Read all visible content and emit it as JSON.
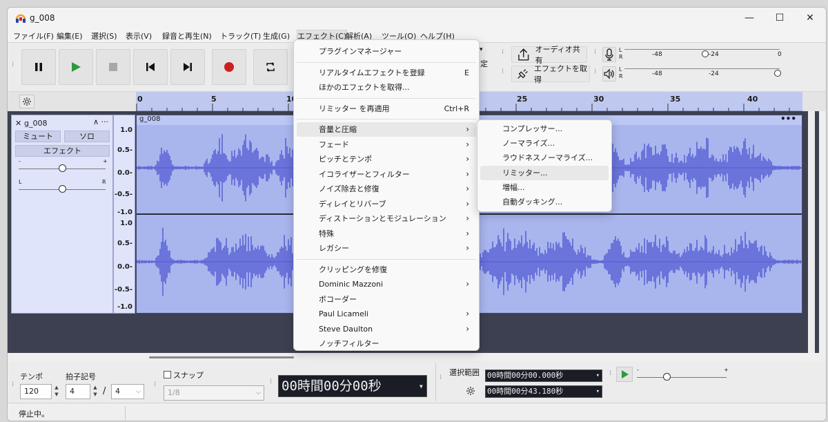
{
  "window": {
    "title": "g_008",
    "minimize": "—",
    "maximize": "☐",
    "close": "✕"
  },
  "menubar": [
    "ファイル(F)",
    "編集(E)",
    "選択(S)",
    "表示(V)",
    "録音と再生(N)",
    "トラック(T)",
    "生成(G)",
    "エフェクト(C)",
    "解析(A)",
    "ツール(O)",
    "ヘルプ(H)"
  ],
  "toolbar": {
    "share_audio": "オーディオ共有",
    "get_effects": "エフェクトを取得",
    "partial_setting_label": "設定",
    "meter_record": {
      "lr": [
        "L",
        "R"
      ],
      "ticks": [
        "-48",
        "-24",
        "0"
      ]
    },
    "meter_play": {
      "lr": [
        "L",
        "R"
      ],
      "ticks": [
        "-48",
        "-24"
      ]
    }
  },
  "ruler": {
    "labels": [
      "0",
      "5",
      "10",
      "25",
      "30",
      "35",
      "40"
    ]
  },
  "track": {
    "name": "g_008",
    "close": "✕",
    "collapse": "∧ ···",
    "mute": "ミュート",
    "solo": "ソロ",
    "effects": "エフェクト",
    "gain_minus": "-",
    "gain_plus": "+",
    "pan_left": "L",
    "pan_right": "R",
    "clip_name": "g_008",
    "clip_menu": "•••",
    "scale_top": [
      "1.0",
      "0.5-",
      "0.0-",
      "-0.5-",
      "-1.0"
    ],
    "scale_bottom": [
      "1.0",
      "0.5-",
      "0.0-",
      "-0.5-",
      "-1.0"
    ],
    "waveform_color": "#5a63d6",
    "clip_color": "#a9b6ee"
  },
  "effects_menu": {
    "items": [
      {
        "label": "プラグインマネージャー"
      },
      {
        "sep": true
      },
      {
        "label": "リアルタイムエフェクトを登録",
        "shortcut": "E"
      },
      {
        "label": "ほかのエフェクトを取得..."
      },
      {
        "sep": true
      },
      {
        "label": "リミッター を再適用",
        "shortcut": "Ctrl+R"
      },
      {
        "sep": true
      },
      {
        "label": "音量と圧縮",
        "submenu": true,
        "highlighted": true
      },
      {
        "label": "フェード",
        "submenu": true
      },
      {
        "label": "ピッチとテンポ",
        "submenu": true
      },
      {
        "label": "イコライザーとフィルター",
        "submenu": true
      },
      {
        "label": "ノイズ除去と修復",
        "submenu": true
      },
      {
        "label": "ディレイとリバーブ",
        "submenu": true
      },
      {
        "label": "ディストーションとモジュレーション",
        "submenu": true
      },
      {
        "label": "特殊",
        "submenu": true
      },
      {
        "label": "レガシー",
        "submenu": true
      },
      {
        "sep": true
      },
      {
        "label": "クリッピングを修復"
      },
      {
        "label": "Dominic Mazzoni",
        "submenu": true
      },
      {
        "label": "ボコーダー"
      },
      {
        "label": "Paul Licameli",
        "submenu": true
      },
      {
        "label": "Steve Daulton",
        "submenu": true
      },
      {
        "label": "ノッチフィルター"
      }
    ]
  },
  "volume_submenu": {
    "items": [
      {
        "label": "コンプレッサー..."
      },
      {
        "label": "ノーマライズ..."
      },
      {
        "label": "ラウドネスノーマライズ..."
      },
      {
        "label": "リミッター...",
        "highlighted": true
      },
      {
        "label": "増幅..."
      },
      {
        "label": "自動ダッキング..."
      }
    ]
  },
  "bottom": {
    "tempo_label": "テンポ",
    "tempo_value": "120",
    "timesig_label": "拍子記号",
    "timesig_num": "4",
    "timesig_sep": "/",
    "timesig_den": "4",
    "snap_label": "スナップ",
    "snap_value": "1/8",
    "time_display": "00時間00分00秒",
    "selection_label": "選択範囲",
    "selection_start": "00時間00分00.000秒",
    "selection_end": "00時間00分43.180秒",
    "play_speed_minus": "-",
    "play_speed_plus": "+"
  },
  "status": {
    "text": "停止中。"
  }
}
